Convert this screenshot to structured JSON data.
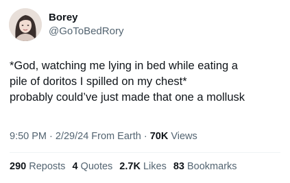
{
  "author": {
    "display_name": "Borey",
    "handle": "@GoToBedRory"
  },
  "tweet": {
    "lines": [
      "*God, watching me lying in bed while eating a",
      "pile of doritos I spilled on my chest*",
      "probably could’ve just made that one a mollusk"
    ]
  },
  "meta": {
    "time": "9:50 PM",
    "sep1": " · ",
    "date": "2/29/24",
    "source": " From Earth",
    "sep2": " · ",
    "views_count": "70K",
    "views_label": " Views"
  },
  "stats": {
    "reposts_count": "290",
    "reposts_label": "Reposts",
    "quotes_count": "4",
    "quotes_label": "Quotes",
    "likes_count": "2.7K",
    "likes_label": "Likes",
    "bookmarks_count": "83",
    "bookmarks_label": "Bookmarks"
  },
  "icons": {
    "avatar": "profile-photo"
  },
  "colors": {
    "text_primary": "#0f1419",
    "text_secondary": "#536471",
    "divider": "#eff3f4"
  }
}
